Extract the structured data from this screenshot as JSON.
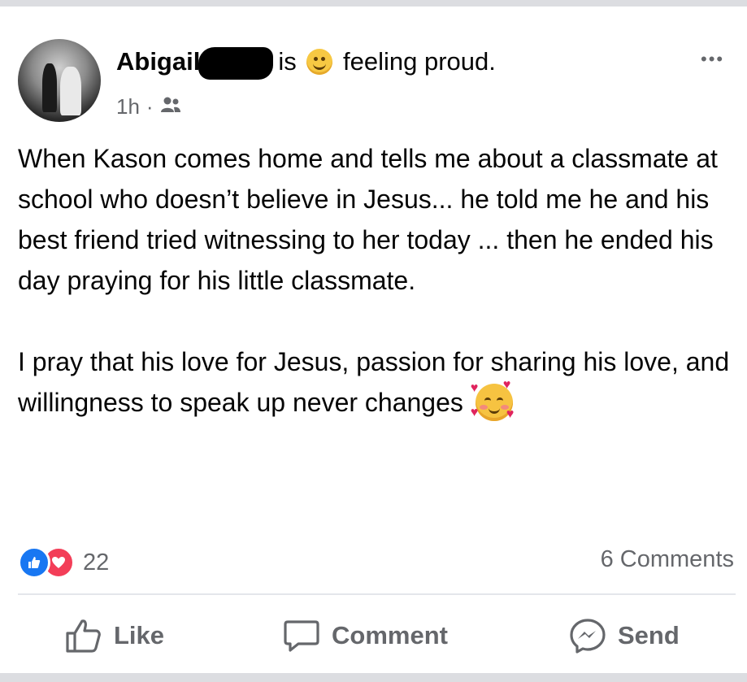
{
  "post": {
    "author": "Abigail",
    "status_verb": "is",
    "feeling_text": "feeling proud.",
    "feeling_icon": "smiling-face-icon",
    "timestamp": "1h",
    "separator": "·",
    "audience_icon": "friends-icon",
    "more_label": "•••",
    "paragraphs": [
      "When Kason comes home and tells me about a classmate at school who doesn’t believe in Jesus... he told me he and his best friend tried witnessing to her today ... then he ended his day praying for his little classmate.",
      "I pray that his love for Jesus, passion for sharing his love, and willingness to speak up never changes"
    ],
    "ending_emoji": "smiling-face-with-hearts-icon"
  },
  "stats": {
    "reaction_types": [
      "like",
      "love"
    ],
    "reactions_count": "22",
    "comments_count": "6 Comments"
  },
  "actions": {
    "like_label": "Like",
    "comment_label": "Comment",
    "send_label": "Send"
  },
  "colors": {
    "like_blue": "#1877f2",
    "love_red": "#f33e58",
    "secondary_text": "#65676b"
  }
}
